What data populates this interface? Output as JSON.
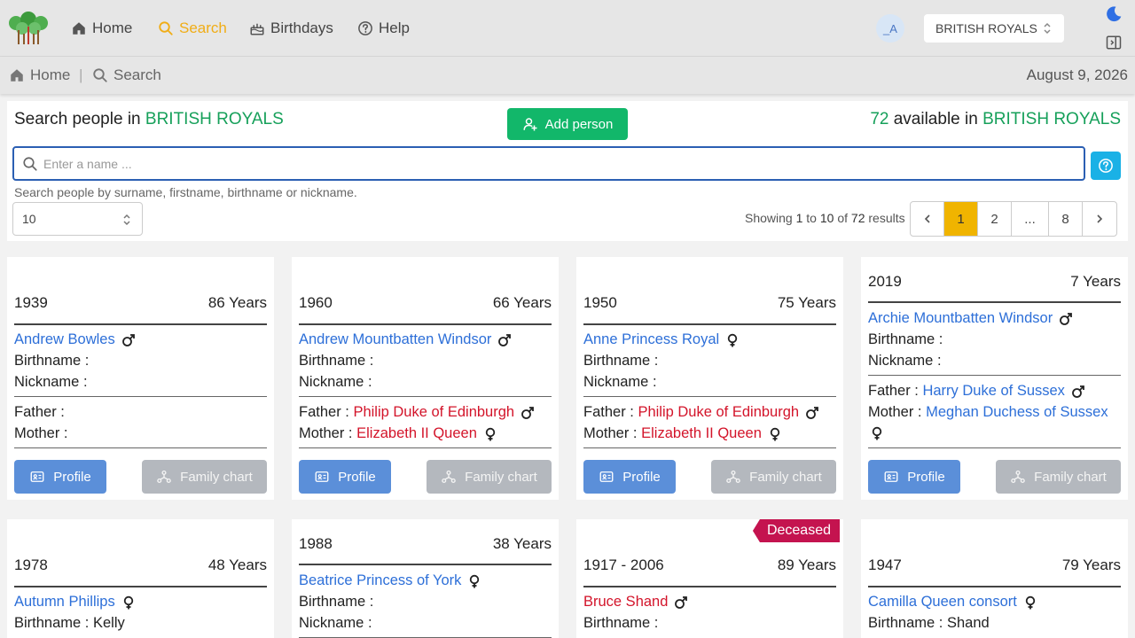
{
  "nav": {
    "items": [
      {
        "label": "Home",
        "icon": "home-icon"
      },
      {
        "label": "Search",
        "icon": "search-icon",
        "active": true
      },
      {
        "label": "Birthdays",
        "icon": "cake-icon"
      },
      {
        "label": "Help",
        "icon": "help-circle-icon"
      }
    ],
    "avatar": "_A",
    "tree_select": "BRITISH ROYALS"
  },
  "breadcrumb": {
    "home": "Home",
    "current": "Search",
    "date": "August 9, 2026"
  },
  "search": {
    "title_prefix": "Search people in",
    "tree": "BRITISH ROYALS",
    "add_label": "Add person",
    "available_count": "72",
    "available_text": "available in",
    "placeholder": "Enter a name ...",
    "hint": "Search people by surname, firstname, birthname or nickname.",
    "per_page": "10",
    "showing": {
      "prefix": "Showing",
      "from": "1",
      "to_word": "to",
      "to": "10",
      "of_word": "of",
      "total": "72",
      "suffix": "results"
    },
    "pages": [
      "1",
      "2",
      "...",
      "8"
    ]
  },
  "labels": {
    "birthname": "Birthname :",
    "nickname": "Nickname :",
    "father": "Father :",
    "mother": "Mother :",
    "profile": "Profile",
    "family_chart": "Family chart",
    "deceased": "Deceased"
  },
  "people": [
    {
      "years": "1939",
      "age": "86 Years",
      "name": "Andrew Bowles",
      "gender": "male",
      "birthname": "",
      "nickname": "",
      "father": "",
      "father_gender": "",
      "mother": "",
      "mother_gender": ""
    },
    {
      "years": "1960",
      "age": "66 Years",
      "name": "Andrew Mountbatten Windsor",
      "gender": "male",
      "birthname": "",
      "nickname": "",
      "father": "Philip Duke of Edinburgh",
      "father_gender": "male",
      "mother": "Elizabeth II Queen",
      "mother_gender": "female"
    },
    {
      "years": "1950",
      "age": "75 Years",
      "name": "Anne Princess Royal",
      "gender": "female",
      "birthname": "",
      "nickname": "",
      "father": "Philip Duke of Edinburgh",
      "father_gender": "male",
      "mother": "Elizabeth II Queen",
      "mother_gender": "female"
    },
    {
      "years": "2019",
      "age": "7 Years",
      "name": "Archie Mountbatten Windsor",
      "gender": "male",
      "birthname": "",
      "nickname": "",
      "father": "Harry Duke of Sussex",
      "father_gender": "male",
      "mother": "Meghan Duchess of Sussex",
      "mother_gender": "female"
    },
    {
      "years": "1978",
      "age": "48 Years",
      "name": "Autumn Phillips",
      "gender": "female",
      "birthname": "Kelly"
    },
    {
      "years": "1988",
      "age": "38 Years",
      "name": "Beatrice Princess of York",
      "gender": "female",
      "birthname": "",
      "nickname": ""
    },
    {
      "years": "1917 - 2006",
      "age": "89 Years",
      "name": "Bruce Shand",
      "gender": "male",
      "birthname": "",
      "deceased": true
    },
    {
      "years": "1947",
      "age": "79 Years",
      "name": "Camilla Queen consort",
      "gender": "female",
      "birthname": "Shand"
    }
  ]
}
